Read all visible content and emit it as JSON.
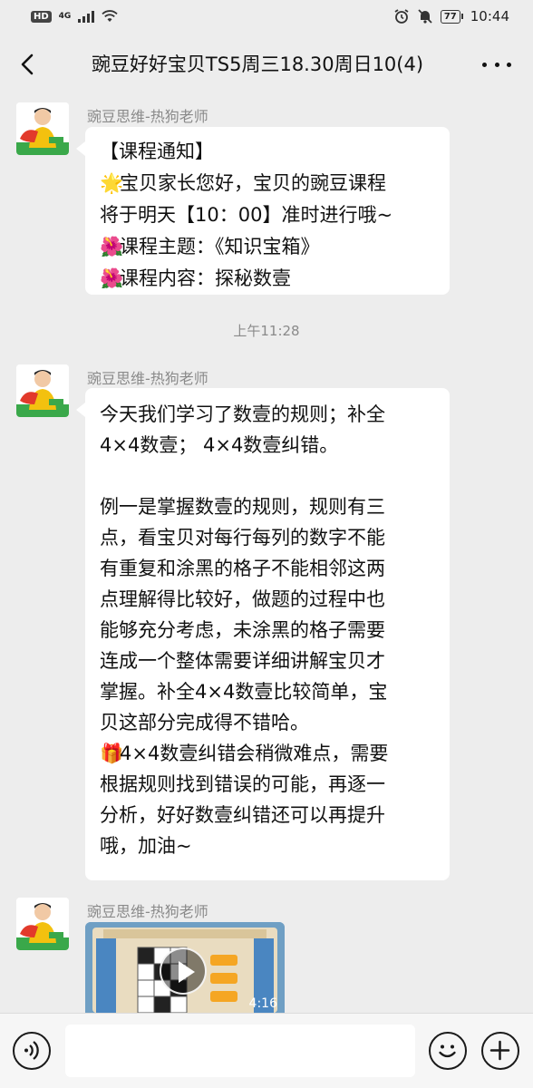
{
  "statusbar": {
    "hd": "HD",
    "network": "4G",
    "battery": "77",
    "time": "10:44"
  },
  "header": {
    "title": "豌豆好好宝贝TS5周三18.30周日10(4)"
  },
  "messages": [
    {
      "sender": "豌豆思维-热狗老师",
      "lines": [
        "【课程通知】",
        "宝贝家长您好，宝贝的豌豆课程",
        "将于明天【10：00】准时进行哦~",
        "课程主题：《知识宝箱》",
        "课程内容：探秘数壹"
      ]
    },
    {
      "timestamp": "上午11:28"
    },
    {
      "sender": "豌豆思维-热狗老师",
      "lines": [
        "今天我们学习了数壹的规则；补全",
        "4×4数壹；  4×4数壹纠错。",
        "",
        "例一是掌握数壹的规则，规则有三",
        "点，看宝贝对每行每列的数字不能",
        "有重复和涂黑的格子不能相邻这两",
        "点理解得比较好，做题的过程中也",
        "能够充分考虑，未涂黑的格子需要",
        "连成一个整体需要详细讲解宝贝才",
        "掌握。补全4×4数壹比较简单，宝",
        "贝这部分完成得不错哈。",
        "4×4数壹纠错会稍微难点，需要",
        "根据规则找到错误的可能，再逐一",
        "分析，好好数壹纠错还可以再提升",
        "哦，加油~"
      ]
    },
    {
      "sender": "豌豆思维-热狗老师",
      "video_duration": "4:16"
    }
  ],
  "emojis": {
    "star": "🌟",
    "flower": "🌺",
    "gift": "🎁"
  },
  "icons": [
    "back-arrow-icon",
    "more-icon",
    "voice-icon",
    "emoji-icon",
    "plus-icon",
    "play-icon"
  ]
}
